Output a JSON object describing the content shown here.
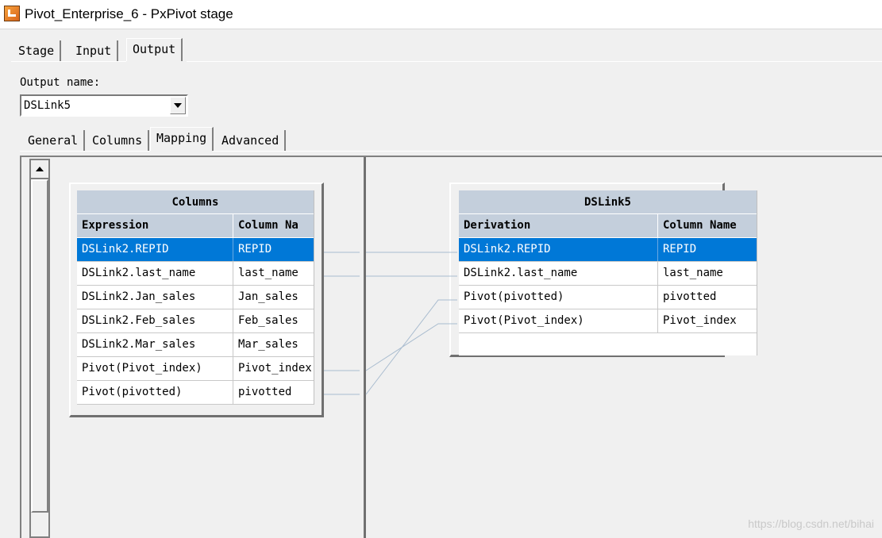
{
  "window": {
    "title": "Pivot_Enterprise_6 - PxPivot stage"
  },
  "main_tabs": [
    {
      "label": "Stage",
      "mnemonic": "t"
    },
    {
      "label": "Input",
      "mnemonic": "I"
    },
    {
      "label": "Output",
      "mnemonic": "O",
      "active": true
    }
  ],
  "output": {
    "label": "Output name:",
    "value": "DSLink5"
  },
  "sub_tabs": [
    {
      "label": "General",
      "mnemonic": "G"
    },
    {
      "label": "Columns",
      "mnemonic": "C"
    },
    {
      "label": "Mapping",
      "mnemonic": "M",
      "active": true
    },
    {
      "label": "Advanced",
      "mnemonic": "v"
    }
  ],
  "columns_panel": {
    "title": "Columns",
    "headers": [
      "Expression",
      "Column Na"
    ],
    "rows": [
      [
        "DSLink2.REPID",
        "REPID"
      ],
      [
        "DSLink2.last_name",
        "last_name"
      ],
      [
        "DSLink2.Jan_sales",
        "Jan_sales"
      ],
      [
        "DSLink2.Feb_sales",
        "Feb_sales"
      ],
      [
        "DSLink2.Mar_sales",
        "Mar_sales"
      ],
      [
        "Pivot(Pivot_index)",
        "Pivot_index"
      ],
      [
        "Pivot(pivotted)",
        "pivotted"
      ]
    ],
    "selected_row": 0
  },
  "dslink_panel": {
    "title": "DSLink5",
    "headers": [
      "Derivation",
      "Column Name"
    ],
    "rows": [
      [
        "DSLink2.REPID",
        "REPID"
      ],
      [
        "DSLink2.last_name",
        "last_name"
      ],
      [
        "Pivot(pivotted)",
        "pivotted"
      ],
      [
        "Pivot(Pivot_index)",
        "Pivot_index"
      ]
    ],
    "selected_row": 0
  },
  "colors": {
    "selection": "#0078d7",
    "header": "#c4cfdc",
    "link_line": "#a9bccf"
  },
  "watermark": "https://blog.csdn.net/bihai"
}
